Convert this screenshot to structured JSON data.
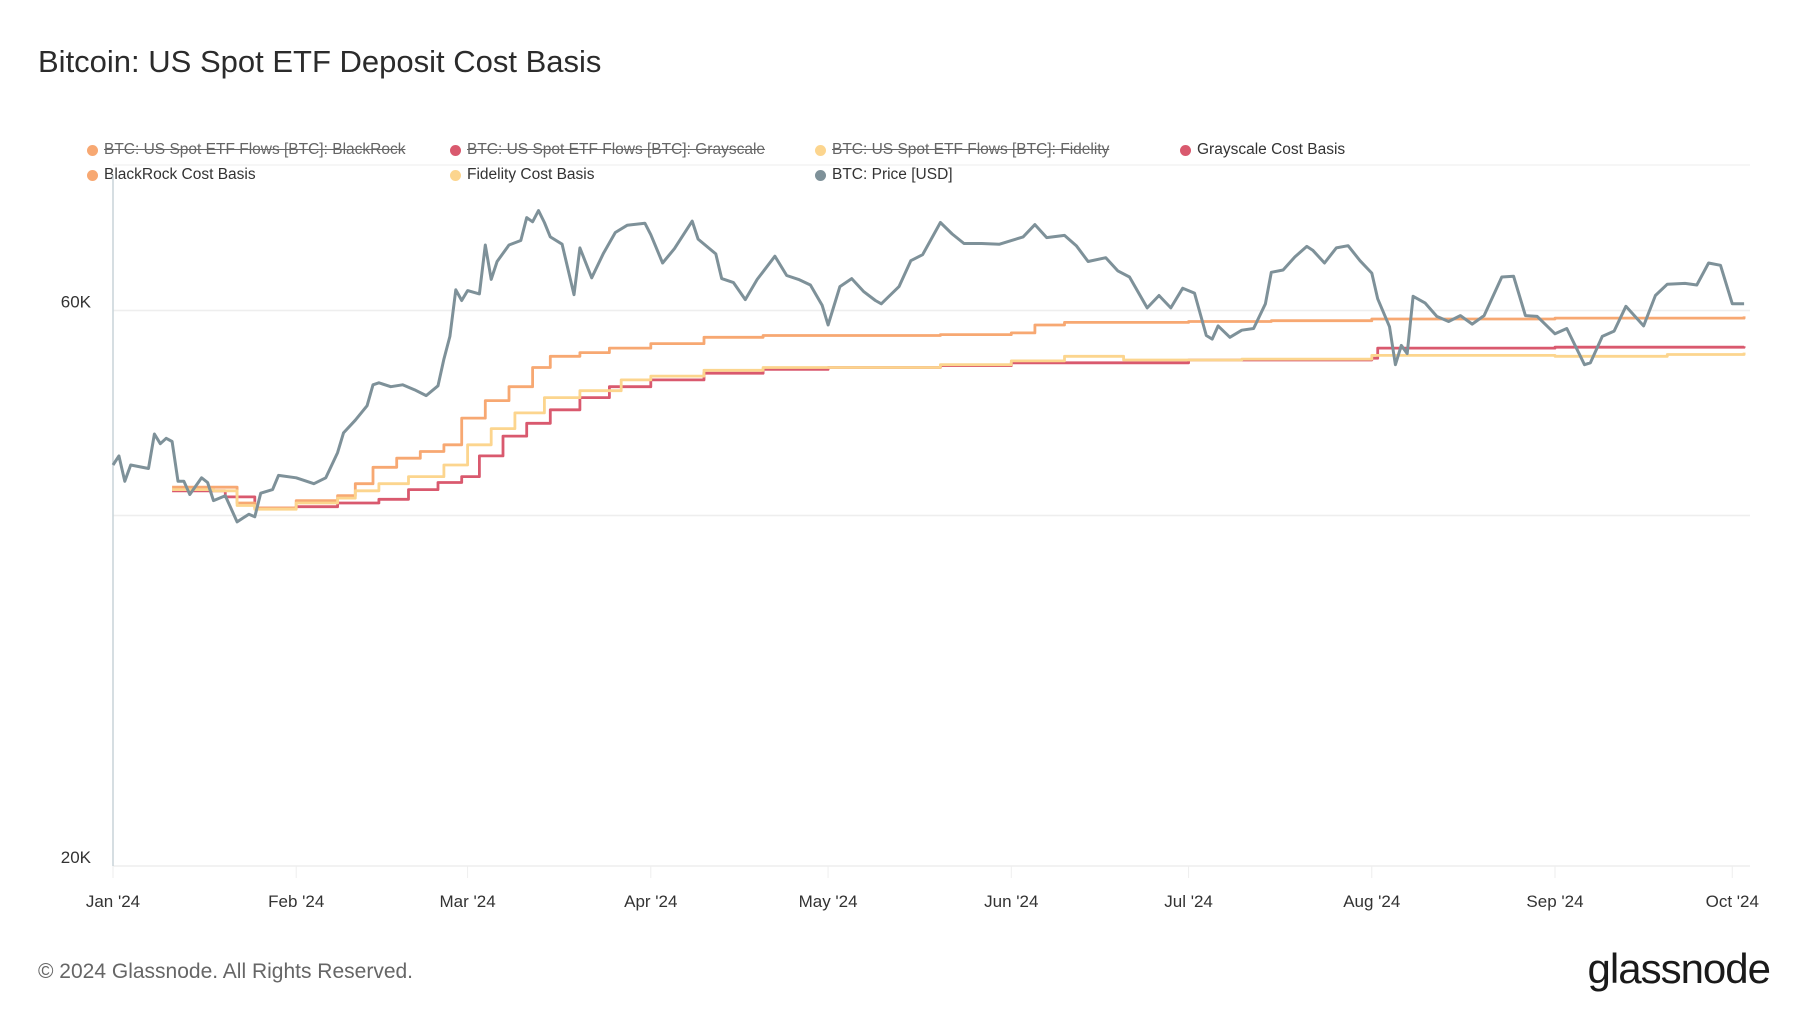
{
  "chart_data": {
    "type": "line",
    "title": "Bitcoin: US Spot ETF Deposit Cost Basis",
    "yscale": "log",
    "ylim": [
      20000,
      80000
    ],
    "yticks": [
      {
        "value": 20000,
        "label": "20K"
      },
      {
        "value": 40000,
        "label": ""
      },
      {
        "value": 60000,
        "label": "60K"
      }
    ],
    "xlim": [
      "2024-01-01",
      "2024-10-04"
    ],
    "xticks": [
      {
        "date": "2024-01-01",
        "label": "Jan '24"
      },
      {
        "date": "2024-02-01",
        "label": "Feb '24"
      },
      {
        "date": "2024-03-01",
        "label": "Mar '24"
      },
      {
        "date": "2024-04-01",
        "label": "Apr '24"
      },
      {
        "date": "2024-05-01",
        "label": "May '24"
      },
      {
        "date": "2024-06-01",
        "label": "Jun '24"
      },
      {
        "date": "2024-07-01",
        "label": "Jul '24"
      },
      {
        "date": "2024-08-01",
        "label": "Aug '24"
      },
      {
        "date": "2024-09-01",
        "label": "Sep '24"
      },
      {
        "date": "2024-10-01",
        "label": "Oct '24"
      }
    ],
    "legend": [
      {
        "label": "BTC: US Spot ETF Flows [BTC]: BlackRock",
        "color": "#f7a872",
        "hidden": true
      },
      {
        "label": "BTC: US Spot ETF Flows [BTC]: Grayscale",
        "color": "#d9596e",
        "hidden": true
      },
      {
        "label": "BTC: US Spot ETF Flows [BTC]: Fidelity",
        "color": "#fcd58e",
        "hidden": true
      },
      {
        "label": "Grayscale Cost Basis",
        "color": "#d9596e",
        "hidden": false
      },
      {
        "label": "BlackRock Cost Basis",
        "color": "#f7a872",
        "hidden": false
      },
      {
        "label": "Fidelity Cost Basis",
        "color": "#fcd58e",
        "hidden": false
      },
      {
        "label": "BTC: Price [USD]",
        "color": "#7e9199",
        "hidden": false
      }
    ],
    "series": [
      {
        "name": "Grayscale Cost Basis",
        "color": "#d9596e",
        "step": true,
        "points": [
          [
            "2024-01-11",
            42000
          ],
          [
            "2024-01-20",
            41500
          ],
          [
            "2024-01-25",
            40600
          ],
          [
            "2024-02-01",
            40700
          ],
          [
            "2024-02-08",
            41000
          ],
          [
            "2024-02-15",
            41300
          ],
          [
            "2024-02-20",
            42100
          ],
          [
            "2024-02-25",
            42700
          ],
          [
            "2024-02-29",
            43200
          ],
          [
            "2024-03-03",
            45000
          ],
          [
            "2024-03-07",
            46800
          ],
          [
            "2024-03-11",
            48000
          ],
          [
            "2024-03-15",
            49300
          ],
          [
            "2024-03-20",
            50500
          ],
          [
            "2024-03-25",
            51600
          ],
          [
            "2024-04-01",
            52300
          ],
          [
            "2024-04-10",
            53000
          ],
          [
            "2024-04-20",
            53400
          ],
          [
            "2024-05-01",
            53600
          ],
          [
            "2024-05-20",
            53800
          ],
          [
            "2024-06-01",
            54100
          ],
          [
            "2024-07-01",
            54400
          ],
          [
            "2024-08-01",
            54600
          ],
          [
            "2024-08-02",
            55700
          ],
          [
            "2024-09-01",
            55800
          ],
          [
            "2024-10-03",
            55900
          ]
        ]
      },
      {
        "name": "BlackRock Cost Basis",
        "color": "#f7a872",
        "step": true,
        "points": [
          [
            "2024-01-11",
            42300
          ],
          [
            "2024-01-18",
            42300
          ],
          [
            "2024-01-22",
            41000
          ],
          [
            "2024-01-25",
            40600
          ],
          [
            "2024-02-01",
            41200
          ],
          [
            "2024-02-08",
            41600
          ],
          [
            "2024-02-11",
            42600
          ],
          [
            "2024-02-14",
            44000
          ],
          [
            "2024-02-18",
            44800
          ],
          [
            "2024-02-22",
            45400
          ],
          [
            "2024-02-26",
            46000
          ],
          [
            "2024-02-29",
            48500
          ],
          [
            "2024-03-04",
            50200
          ],
          [
            "2024-03-08",
            51600
          ],
          [
            "2024-03-12",
            53600
          ],
          [
            "2024-03-15",
            54800
          ],
          [
            "2024-03-20",
            55200
          ],
          [
            "2024-03-25",
            55700
          ],
          [
            "2024-04-01",
            56200
          ],
          [
            "2024-04-10",
            56900
          ],
          [
            "2024-04-20",
            57100
          ],
          [
            "2024-05-01",
            57100
          ],
          [
            "2024-05-20",
            57200
          ],
          [
            "2024-06-01",
            57400
          ],
          [
            "2024-06-05",
            58300
          ],
          [
            "2024-06-10",
            58600
          ],
          [
            "2024-07-01",
            58700
          ],
          [
            "2024-07-15",
            58800
          ],
          [
            "2024-08-01",
            59000
          ],
          [
            "2024-09-01",
            59100
          ],
          [
            "2024-10-03",
            59300
          ]
        ]
      },
      {
        "name": "Fidelity Cost Basis",
        "color": "#fcd58e",
        "step": true,
        "points": [
          [
            "2024-01-11",
            42100
          ],
          [
            "2024-01-18",
            42000
          ],
          [
            "2024-01-22",
            40800
          ],
          [
            "2024-01-25",
            40500
          ],
          [
            "2024-02-01",
            41000
          ],
          [
            "2024-02-08",
            41400
          ],
          [
            "2024-02-11",
            42000
          ],
          [
            "2024-02-15",
            42600
          ],
          [
            "2024-02-20",
            43200
          ],
          [
            "2024-02-26",
            44200
          ],
          [
            "2024-03-01",
            46000
          ],
          [
            "2024-03-05",
            47500
          ],
          [
            "2024-03-09",
            49000
          ],
          [
            "2024-03-14",
            50500
          ],
          [
            "2024-03-20",
            51200
          ],
          [
            "2024-03-27",
            52300
          ],
          [
            "2024-04-01",
            52700
          ],
          [
            "2024-04-10",
            53300
          ],
          [
            "2024-04-20",
            53600
          ],
          [
            "2024-05-01",
            53600
          ],
          [
            "2024-05-20",
            53900
          ],
          [
            "2024-06-01",
            54300
          ],
          [
            "2024-06-10",
            54800
          ],
          [
            "2024-06-20",
            54400
          ],
          [
            "2024-07-10",
            54500
          ],
          [
            "2024-08-01",
            54900
          ],
          [
            "2024-09-01",
            54800
          ],
          [
            "2024-09-20",
            55000
          ],
          [
            "2024-10-03",
            55200
          ]
        ]
      },
      {
        "name": "BTC: Price [USD]",
        "color": "#7e9199",
        "step": false,
        "points": [
          [
            "2024-01-01",
            44200
          ],
          [
            "2024-01-02",
            45000
          ],
          [
            "2024-01-03",
            42800
          ],
          [
            "2024-01-04",
            44200
          ],
          [
            "2024-01-07",
            43900
          ],
          [
            "2024-01-08",
            47000
          ],
          [
            "2024-01-09",
            46100
          ],
          [
            "2024-01-10",
            46600
          ],
          [
            "2024-01-11",
            46300
          ],
          [
            "2024-01-12",
            42800
          ],
          [
            "2024-01-13",
            42800
          ],
          [
            "2024-01-14",
            41700
          ],
          [
            "2024-01-16",
            43100
          ],
          [
            "2024-01-17",
            42700
          ],
          [
            "2024-01-18",
            41200
          ],
          [
            "2024-01-20",
            41600
          ],
          [
            "2024-01-22",
            39500
          ],
          [
            "2024-01-23",
            39800
          ],
          [
            "2024-01-24",
            40100
          ],
          [
            "2024-01-25",
            39900
          ],
          [
            "2024-01-26",
            41800
          ],
          [
            "2024-01-28",
            42100
          ],
          [
            "2024-01-29",
            43300
          ],
          [
            "2024-02-01",
            43100
          ],
          [
            "2024-02-04",
            42600
          ],
          [
            "2024-02-06",
            43100
          ],
          [
            "2024-02-08",
            45300
          ],
          [
            "2024-02-09",
            47100
          ],
          [
            "2024-02-11",
            48300
          ],
          [
            "2024-02-13",
            49700
          ],
          [
            "2024-02-14",
            51800
          ],
          [
            "2024-02-15",
            52000
          ],
          [
            "2024-02-17",
            51600
          ],
          [
            "2024-02-19",
            51800
          ],
          [
            "2024-02-21",
            51300
          ],
          [
            "2024-02-23",
            50700
          ],
          [
            "2024-02-25",
            51700
          ],
          [
            "2024-02-26",
            54500
          ],
          [
            "2024-02-27",
            57000
          ],
          [
            "2024-02-28",
            62500
          ],
          [
            "2024-02-29",
            61200
          ],
          [
            "2024-03-01",
            62400
          ],
          [
            "2024-03-03",
            62000
          ],
          [
            "2024-03-04",
            68300
          ],
          [
            "2024-03-05",
            63800
          ],
          [
            "2024-03-06",
            66100
          ],
          [
            "2024-03-08",
            68300
          ],
          [
            "2024-03-10",
            68900
          ],
          [
            "2024-03-11",
            72100
          ],
          [
            "2024-03-12",
            71500
          ],
          [
            "2024-03-13",
            73100
          ],
          [
            "2024-03-14",
            71400
          ],
          [
            "2024-03-15",
            69400
          ],
          [
            "2024-03-17",
            68400
          ],
          [
            "2024-03-19",
            61900
          ],
          [
            "2024-03-20",
            67900
          ],
          [
            "2024-03-22",
            64000
          ],
          [
            "2024-03-24",
            67200
          ],
          [
            "2024-03-26",
            70000
          ],
          [
            "2024-03-28",
            71000
          ],
          [
            "2024-03-31",
            71300
          ],
          [
            "2024-04-01",
            69700
          ],
          [
            "2024-04-03",
            65900
          ],
          [
            "2024-04-05",
            67800
          ],
          [
            "2024-04-08",
            71600
          ],
          [
            "2024-04-09",
            69100
          ],
          [
            "2024-04-12",
            67100
          ],
          [
            "2024-04-13",
            63900
          ],
          [
            "2024-04-15",
            63400
          ],
          [
            "2024-04-17",
            61300
          ],
          [
            "2024-04-19",
            63800
          ],
          [
            "2024-04-22",
            66800
          ],
          [
            "2024-04-24",
            64300
          ],
          [
            "2024-04-26",
            63800
          ],
          [
            "2024-04-28",
            63100
          ],
          [
            "2024-04-30",
            60600
          ],
          [
            "2024-05-01",
            58300
          ],
          [
            "2024-05-03",
            62900
          ],
          [
            "2024-05-05",
            63900
          ],
          [
            "2024-05-07",
            62300
          ],
          [
            "2024-05-09",
            61200
          ],
          [
            "2024-05-10",
            60800
          ],
          [
            "2024-05-13",
            62900
          ],
          [
            "2024-05-15",
            66200
          ],
          [
            "2024-05-17",
            67000
          ],
          [
            "2024-05-20",
            71400
          ],
          [
            "2024-05-22",
            69800
          ],
          [
            "2024-05-24",
            68500
          ],
          [
            "2024-05-27",
            68500
          ],
          [
            "2024-05-30",
            68400
          ],
          [
            "2024-06-03",
            69400
          ],
          [
            "2024-06-05",
            71100
          ],
          [
            "2024-06-07",
            69300
          ],
          [
            "2024-06-10",
            69600
          ],
          [
            "2024-06-12",
            68200
          ],
          [
            "2024-06-14",
            66100
          ],
          [
            "2024-06-17",
            66600
          ],
          [
            "2024-06-19",
            64900
          ],
          [
            "2024-06-21",
            64100
          ],
          [
            "2024-06-24",
            60300
          ],
          [
            "2024-06-26",
            61800
          ],
          [
            "2024-06-28",
            60300
          ],
          [
            "2024-06-30",
            62700
          ],
          [
            "2024-07-02",
            62100
          ],
          [
            "2024-07-04",
            57100
          ],
          [
            "2024-07-05",
            56700
          ],
          [
            "2024-07-06",
            58200
          ],
          [
            "2024-07-08",
            56900
          ],
          [
            "2024-07-10",
            57700
          ],
          [
            "2024-07-12",
            57900
          ],
          [
            "2024-07-14",
            60800
          ],
          [
            "2024-07-15",
            64700
          ],
          [
            "2024-07-17",
            65000
          ],
          [
            "2024-07-19",
            66700
          ],
          [
            "2024-07-21",
            68100
          ],
          [
            "2024-07-22",
            67600
          ],
          [
            "2024-07-24",
            65900
          ],
          [
            "2024-07-26",
            67900
          ],
          [
            "2024-07-28",
            68200
          ],
          [
            "2024-07-30",
            66200
          ],
          [
            "2024-08-01",
            64600
          ],
          [
            "2024-08-02",
            61400
          ],
          [
            "2024-08-04",
            58100
          ],
          [
            "2024-08-05",
            53900
          ],
          [
            "2024-08-06",
            56000
          ],
          [
            "2024-08-07",
            55100
          ],
          [
            "2024-08-08",
            61700
          ],
          [
            "2024-08-10",
            60900
          ],
          [
            "2024-08-12",
            59300
          ],
          [
            "2024-08-14",
            58700
          ],
          [
            "2024-08-16",
            59400
          ],
          [
            "2024-08-18",
            58400
          ],
          [
            "2024-08-20",
            59400
          ],
          [
            "2024-08-23",
            64100
          ],
          [
            "2024-08-25",
            64200
          ],
          [
            "2024-08-27",
            59400
          ],
          [
            "2024-08-29",
            59300
          ],
          [
            "2024-09-01",
            57300
          ],
          [
            "2024-09-03",
            57900
          ],
          [
            "2024-09-06",
            53900
          ],
          [
            "2024-09-07",
            54100
          ],
          [
            "2024-09-09",
            57000
          ],
          [
            "2024-09-11",
            57600
          ],
          [
            "2024-09-13",
            60500
          ],
          [
            "2024-09-16",
            58200
          ],
          [
            "2024-09-18",
            61800
          ],
          [
            "2024-09-20",
            63200
          ],
          [
            "2024-09-23",
            63300
          ],
          [
            "2024-09-25",
            63100
          ],
          [
            "2024-09-27",
            65900
          ],
          [
            "2024-09-29",
            65600
          ],
          [
            "2024-10-01",
            60800
          ],
          [
            "2024-10-03",
            60800
          ]
        ]
      }
    ]
  },
  "footer": {
    "copyright": "© 2024 Glassnode. All Rights Reserved.",
    "logo": "glassnode"
  }
}
